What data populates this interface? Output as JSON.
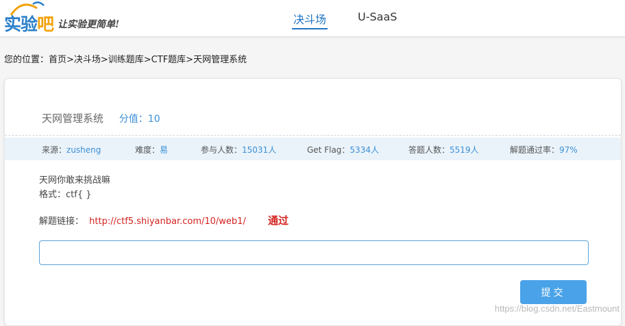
{
  "header": {
    "logo_text_main": "实验",
    "logo_text_accent": "吧",
    "slogan": "让实验更简单!",
    "nav": [
      {
        "label": "决斗场",
        "active": true
      },
      {
        "label": "U-SaaS",
        "active": false
      }
    ]
  },
  "breadcrumb": "您的位置：首页>决斗场>训练题库>CTF题库>天网管理系统",
  "problem": {
    "title": "天网管理系统",
    "score_label": "分值：",
    "score_value": "10"
  },
  "stats": [
    {
      "label": "来源：",
      "value": "zusheng"
    },
    {
      "label": "难度：",
      "value": "易"
    },
    {
      "label": "参与人数：",
      "value": "15031人"
    },
    {
      "label": "Get Flag：",
      "value": "5334人"
    },
    {
      "label": "答题人数：",
      "value": "5519人"
    },
    {
      "label": "解题通过率：",
      "value": "97%"
    }
  ],
  "description": {
    "line1": "天网你敢来挑战嘛",
    "line2": "格式：ctf{ }"
  },
  "solve": {
    "label": "解题链接：",
    "url": "http://ctf5.shiyanbar.com/10/web1/",
    "status": "通过"
  },
  "answer": {
    "value": "",
    "placeholder": ""
  },
  "submit_label": "提交",
  "watermark": "https://blog.csdn.net/Eastmount",
  "colors": {
    "accent": "#1f74c3",
    "link": "#d3231f",
    "button": "#4aa3e8"
  }
}
